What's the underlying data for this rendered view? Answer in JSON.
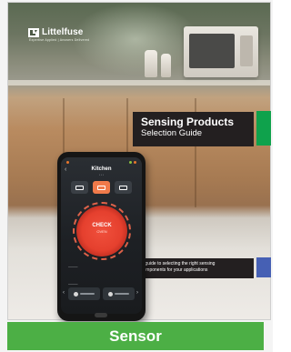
{
  "brand": {
    "name": "Littelfuse",
    "tagline": "Expertise Applied | Answers Delivered",
    "logo_icon": "littelfuse-logo-icon"
  },
  "cover": {
    "title": "Sensing Products",
    "subtitle": "Selection Guide",
    "description_line_1": "A guide to selecting the right sensing",
    "description_line_2": "components for your applications",
    "accent_top_color": "#0fa24c",
    "accent_bottom_color": "#4660b4"
  },
  "phone_app": {
    "title": "Kitchen",
    "dial_value": "CHECK",
    "dial_unit": "OVEN"
  },
  "footer": {
    "label": "Sensor",
    "color": "#4caf45"
  }
}
